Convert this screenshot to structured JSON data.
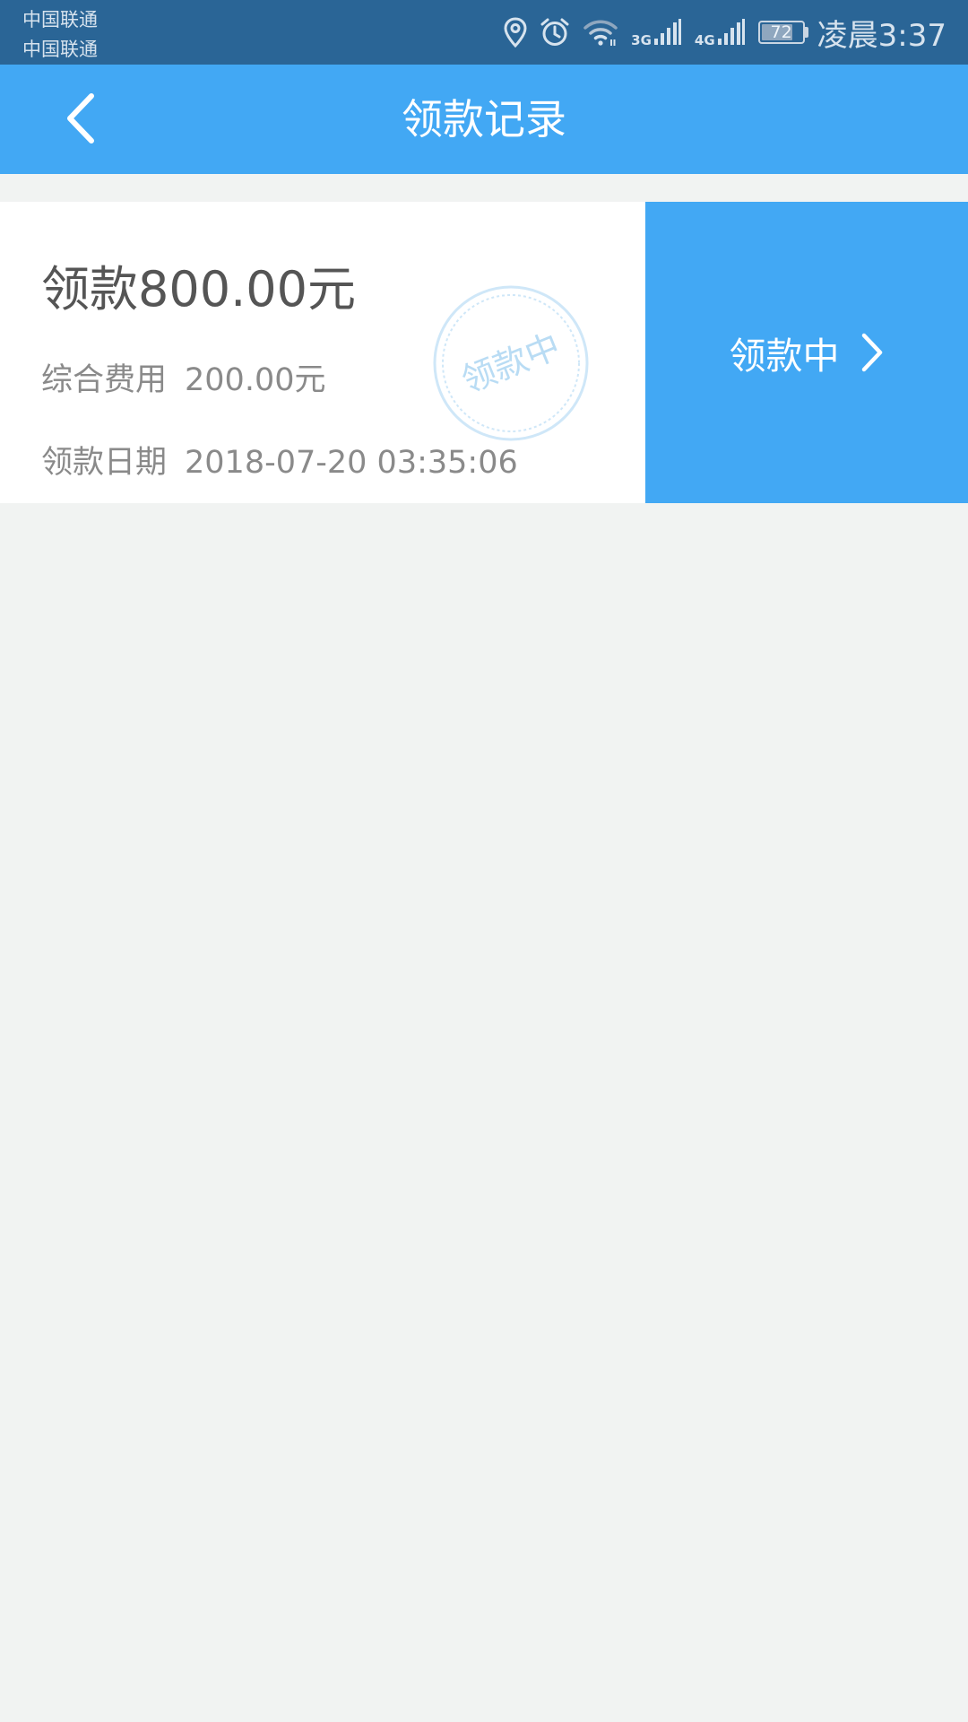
{
  "status_bar": {
    "carriers": [
      "中国联通",
      "中国联通"
    ],
    "net_types": [
      "3G",
      "4G"
    ],
    "battery_level": "72",
    "time": "凌晨3:37",
    "icons": [
      "location-icon",
      "alarm-icon",
      "wifi-icon",
      "signal-icon",
      "signal-icon",
      "battery-icon"
    ]
  },
  "header": {
    "title": "领款记录",
    "back_icon": "chevron-left-icon"
  },
  "record": {
    "amount": "领款800.00元",
    "fee_label": "综合费用",
    "fee_value": "200.00元",
    "date_label": "领款日期",
    "date_value": "2018-07-20 03:35:06",
    "stamp_text": "领款中",
    "status_label": "领款中",
    "status_icon": "chevron-right-icon"
  },
  "colors": {
    "status_bar": "#2a6596",
    "accent": "#42a8f4",
    "background": "#f1f3f2",
    "card": "#ffffff",
    "stamp": "#b9dcf4"
  }
}
